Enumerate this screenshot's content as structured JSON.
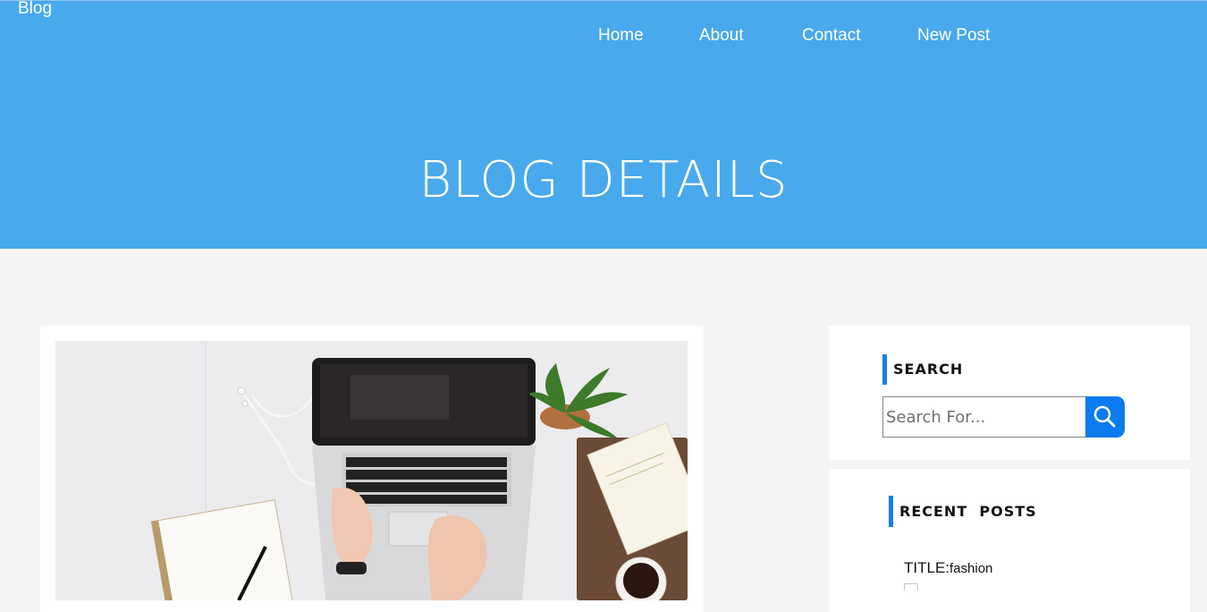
{
  "header": {
    "brand": "Blog",
    "nav": [
      "Home",
      "About",
      "Contact",
      "New Post"
    ],
    "hero_title": "BLOG DETAILS"
  },
  "post": {
    "image_alt": "Laptop on desk with plant, book and coffee"
  },
  "sidebar": {
    "search": {
      "title": "SEARCH",
      "placeholder": "Search For...",
      "button_icon": "search-icon"
    },
    "recent_posts": {
      "title": "RECENT  POSTS",
      "items": [
        {
          "label": "TITLE:",
          "value": "fashion"
        }
      ]
    }
  },
  "colors": {
    "hero_bg": "#48a9ec",
    "accent": "#1a7fe0",
    "search_button": "#0a7cf0",
    "page_bg": "#f4f4f4"
  }
}
